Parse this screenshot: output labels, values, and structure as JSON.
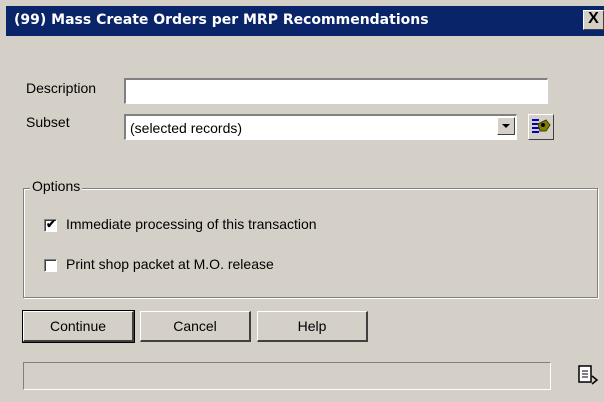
{
  "window": {
    "title": "(99) Mass Create Orders per MRP Recommendations",
    "close_glyph": "X"
  },
  "form": {
    "description": {
      "label": "Description",
      "value": "",
      "placeholder": ""
    },
    "subset": {
      "label": "Subset",
      "value": "(selected records)"
    }
  },
  "options": {
    "legend": "Options",
    "items": [
      {
        "label": "Immediate processing of this transaction",
        "checked": true,
        "mark": "✔"
      },
      {
        "label": "Print shop packet at M.O. release",
        "checked": false,
        "mark": ""
      }
    ]
  },
  "buttons": {
    "continue": "Continue",
    "cancel": "Cancel",
    "help": "Help"
  },
  "status": {
    "text": ""
  },
  "colors": {
    "title_bar": "#0a246a",
    "dialog_bg": "#d4d0c8"
  }
}
